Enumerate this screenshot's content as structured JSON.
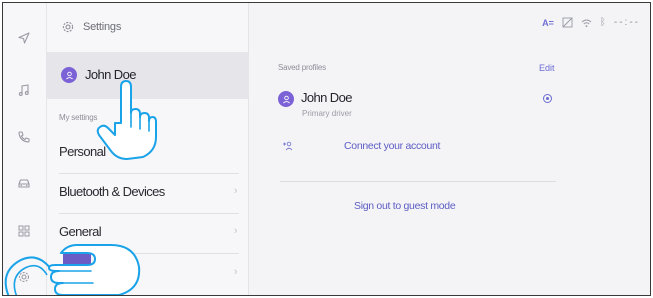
{
  "rail": {
    "icons": [
      "navigation-icon",
      "music-icon",
      "phone-icon",
      "car-icon",
      "apps-grid-icon",
      "settings-icon"
    ]
  },
  "settings": {
    "title": "Settings",
    "profile_name": "John Doe",
    "section_label": "My settings",
    "items": [
      {
        "label": "Personal"
      },
      {
        "label": "Bluetooth & Devices"
      },
      {
        "label": "General"
      }
    ]
  },
  "status_bar": {
    "text_size": "A=",
    "clock": "--:--"
  },
  "profiles": {
    "section_label": "Saved profiles",
    "edit_label": "Edit",
    "current": {
      "name": "John Doe",
      "role": "Primary driver"
    },
    "connect_label": "Connect your account",
    "signout_label": "Sign out to guest mode"
  },
  "colors": {
    "accent": "#6b6bd3",
    "avatar": "#7b62d6",
    "hand_outline": "#1aa3e8"
  }
}
